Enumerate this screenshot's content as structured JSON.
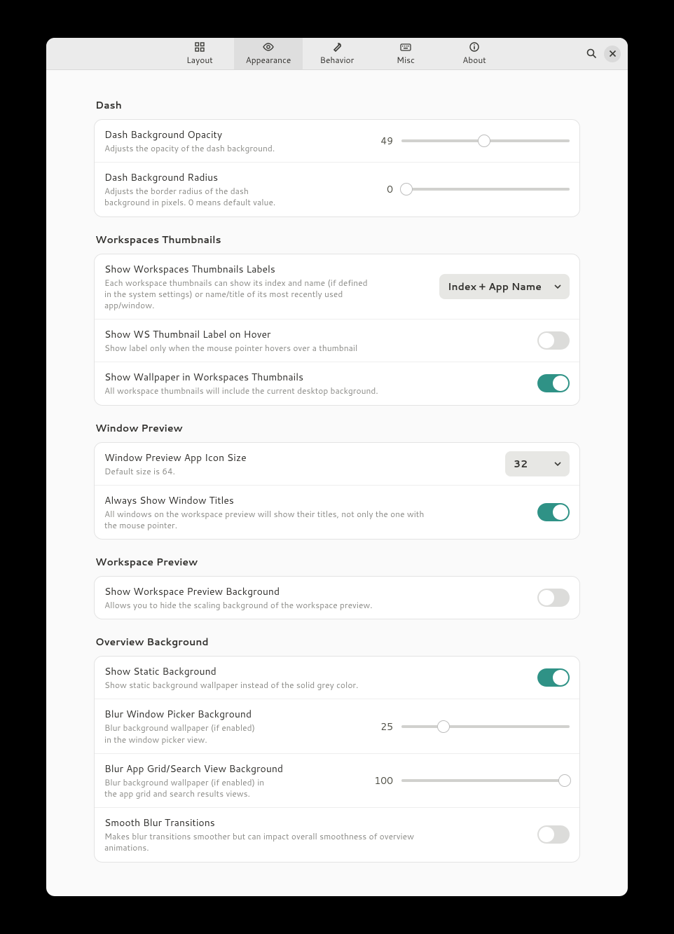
{
  "tabs": {
    "layout": "Layout",
    "appearance": "Appearance",
    "behavior": "Behavior",
    "misc": "Misc",
    "about": "About"
  },
  "sections": {
    "dash": {
      "title": "Dash",
      "opacity": {
        "title": "Dash Background Opacity",
        "desc": "Adjusts the opacity of the dash background.",
        "value": "49"
      },
      "radius": {
        "title": "Dash Background Radius",
        "desc": "Adjusts the border radius of the dash background in pixels. 0 means default value.",
        "value": "0"
      }
    },
    "wst": {
      "title": "Workspaces Thumbnails",
      "labels": {
        "title": "Show Workspaces Thumbnails Labels",
        "desc": "Each workspace thumbnails can show its index and name (if defined in the system settings) or name/title of its most recently used app/window.",
        "value": "Index + App Name"
      },
      "hover": {
        "title": "Show WS Thumbnail Label on Hover",
        "desc": "Show label only when the mouse pointer hovers over a thumbnail"
      },
      "wallpaper": {
        "title": "Show Wallpaper in Workspaces Thumbnails",
        "desc": "All workspace thumbnails will include the current desktop background."
      }
    },
    "winprev": {
      "title": "Window Preview",
      "iconsize": {
        "title": "Window Preview App Icon Size",
        "desc": "Default size is 64.",
        "value": "32"
      },
      "titles": {
        "title": "Always Show Window Titles",
        "desc": "All windows on the workspace preview will show their titles, not only the one with the mouse pointer."
      }
    },
    "wsprev": {
      "title": "Workspace Preview",
      "bg": {
        "title": "Show Workspace Preview Background",
        "desc": "Allows you to hide the scaling background of the workspace preview."
      }
    },
    "ovbg": {
      "title": "Overview Background",
      "static": {
        "title": "Show Static Background",
        "desc": "Show static background wallpaper instead of the solid grey color."
      },
      "blurpicker": {
        "title": "Blur Window Picker Background",
        "desc": "Blur background wallpaper (if enabled) in the window picker view.",
        "value": "25"
      },
      "blurgrid": {
        "title": "Blur App Grid/Search View Background",
        "desc": "Blur background wallpaper (if enabled) in the app grid and search results views.",
        "value": "100"
      },
      "smooth": {
        "title": "Smooth Blur Transitions",
        "desc": "Makes blur transitions smoother but can impact overall smoothness of overview animations."
      }
    }
  }
}
